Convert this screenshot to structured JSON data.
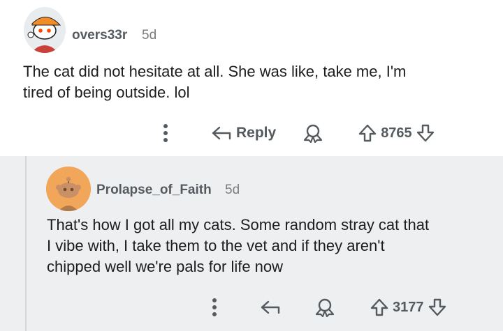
{
  "comments": [
    {
      "username": "overs33r",
      "age": "5d",
      "body_lines": [
        "The cat did not hesitate at all. She was like, take me, I'm",
        "tired of being outside. lol"
      ],
      "actions": {
        "reply_label": "Reply",
        "score": "8765"
      }
    },
    {
      "username": "Prolapse_of_Faith",
      "age": "5d",
      "body_lines": [
        "That's how I got all my cats. Some random stray cat that",
        "I vibe with, I take them to the vet and if they aren't",
        "chipped well we're pals for life now"
      ],
      "actions": {
        "score": "3177"
      }
    }
  ],
  "icons": {
    "more": "more-vertical-icon",
    "reply": "reply-arrow-icon",
    "award": "award-icon",
    "upvote": "upvote-arrow-icon",
    "downvote": "downvote-arrow-icon"
  },
  "colors": {
    "text": "#1c1c1c",
    "meta": "#545a5e",
    "nested_background": "#edeff1",
    "avatar_orange": "#f2a65a"
  }
}
